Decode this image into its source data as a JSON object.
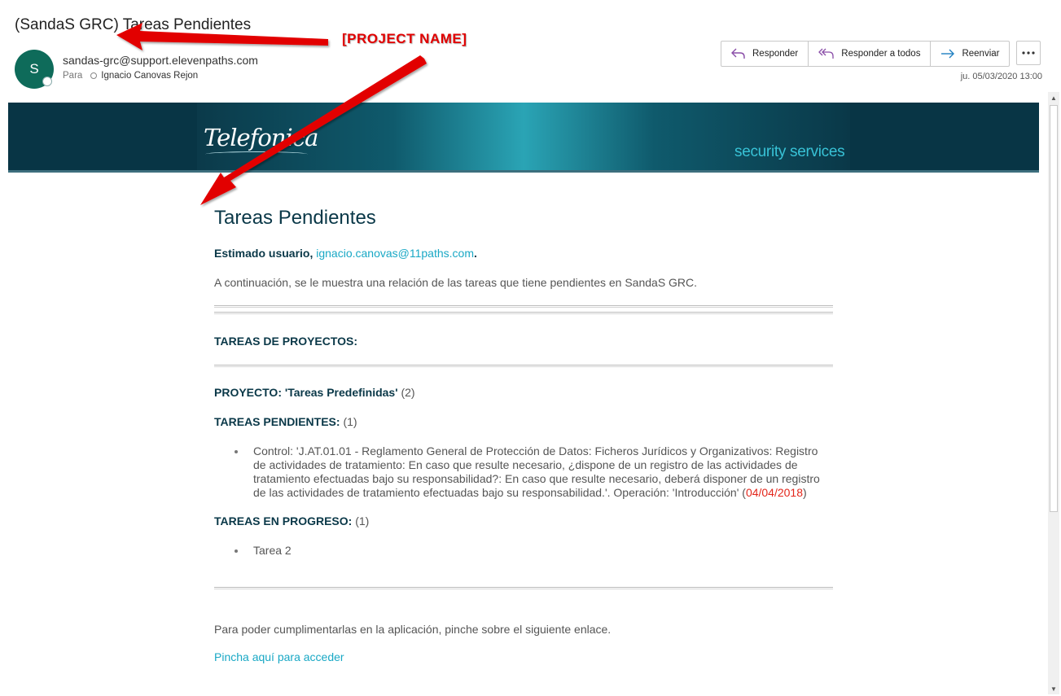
{
  "email": {
    "subject": "(SandaS GRC) Tareas Pendientes",
    "avatar_initial": "S",
    "sender": "sandas-grc@support.elevenpaths.com",
    "to_label": "Para",
    "recipient": "Ignacio Canovas Rejon",
    "date": "ju. 05/03/2020 13:00"
  },
  "actions": {
    "reply": "Responder",
    "reply_all": "Responder a todos",
    "forward": "Reenviar",
    "more_icon": "more-icon"
  },
  "banner": {
    "logo": "Telefonica",
    "tagline": "security services",
    "background_color": "#083545",
    "tagline_color": "#38c2d6"
  },
  "body": {
    "title": "Tareas Pendientes",
    "greeting_prefix": "Estimado usuario,",
    "greeting_email": "ignacio.canovas@11paths.com",
    "greeting_suffix": ".",
    "intro": "A continuación, se le muestra una relación de las tareas que tiene pendientes en SandaS GRC.",
    "projects_heading": "TAREAS DE PROYECTOS:",
    "project_label": "PROYECTO: 'Tareas Predefinidas'",
    "project_count": "(2)",
    "pending_label": "TAREAS PENDIENTES:",
    "pending_count": "(1)",
    "pending_task_text": "Control: 'J.AT.01.01 - Reglamento General de Protección de Datos: Ficheros Jurídicos y Organizativos: Registro de actividades de tratamiento: En caso que resulte necesario, ¿dispone de un registro de las actividades de tratamiento efectuadas bajo su responsabilidad?: En caso que resulte necesario, deberá disponer de un registro de las actividades de tratamiento efectuadas bajo su responsabilidad.'. Operación: 'Introducción' (",
    "pending_task_date": "04/04/2018",
    "pending_task_close": ")",
    "in_progress_label": "TAREAS EN PROGRESO:",
    "in_progress_count": "(1)",
    "in_progress_task": "Tarea 2",
    "footer_text": "Para poder cumplimentarlas en la aplicación, pinche sobre el siguiente enlace.",
    "access_link": "Pincha aquí para acceder",
    "link_color": "#19a8c5",
    "due_color": "#e3261b"
  },
  "annotation": {
    "label": "[PROJECT  NAME]",
    "color": "#e10000"
  }
}
